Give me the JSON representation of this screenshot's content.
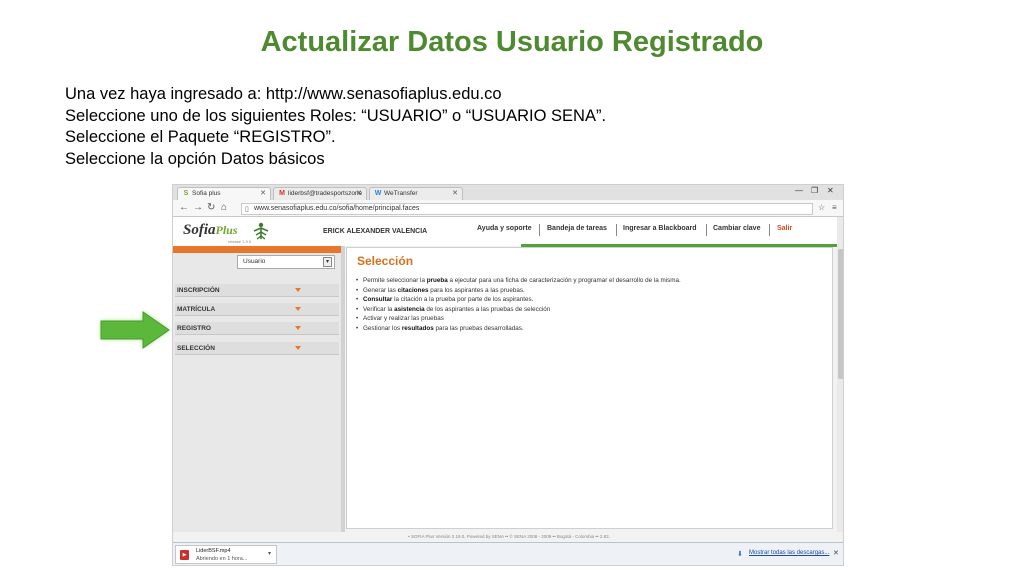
{
  "slide": {
    "title": "Actualizar Datos Usuario Registrado",
    "lines": [
      "Una vez haya ingresado a: http://www.senasofiaplus.edu.co",
      "Seleccione uno de los siguientes Roles: “USUARIO” o “USUARIO SENA”.",
      "Seleccione el Paquete “REGISTRO”.",
      "Seleccione la opción Datos básicos"
    ]
  },
  "browser": {
    "tabs": [
      {
        "label": "Sofia plus",
        "icon": "sofia-favicon"
      },
      {
        "label": "liderbsf@tradesportszone",
        "icon": "gmail-favicon"
      },
      {
        "label": "WeTransfer",
        "icon": "wetransfer-favicon"
      }
    ],
    "url": "www.senasofiaplus.edu.co/sofia/home/principal.faces"
  },
  "site": {
    "logo_text": "Sofia",
    "logo_plus": "Plus",
    "logo_version": "release 1.9.0",
    "user_name": "ERICK ALEXANDER VALENCIA",
    "nav": {
      "help": "Ayuda y soporte",
      "tasks": "Bandeja de tareas",
      "blackboard": "Ingresar a Blackboard",
      "change_password": "Cambiar clave",
      "logout": "Salir"
    },
    "role_selected": "Usuario",
    "menu": [
      "INSCRIPCIÓN",
      "MATRÍCULA",
      "REGISTRO",
      "SELECCIÓN"
    ],
    "content": {
      "title": "Selección",
      "bullets": [
        {
          "pre": "Permite seleccionar la ",
          "bold": "prueba",
          "post": " a ejecutar para una ficha de caracterización y programar el desarrollo de la misma."
        },
        {
          "pre": "Generar las ",
          "bold": "citaciones",
          "post": " para los aspirantes a las pruebas."
        },
        {
          "pre": "",
          "bold": "Consultar",
          "post": " la citación a la prueba por parte de los aspirantes."
        },
        {
          "pre": "Verificar la ",
          "bold": "asistencia",
          "post": " de los aspirantes a las pruebas de selección"
        },
        {
          "pre": "Activar y realizar las pruebas",
          "bold": "",
          "post": ""
        },
        {
          "pre": "Gestionar los ",
          "bold": "resultados",
          "post": " para las pruebas desarrolladas."
        }
      ]
    },
    "footer": "• SOFIA Plus Versión 2.19.0, Powered by SENA •• © SENA 2008 - 2009 •• Bogotá - Colombia •• 2.83."
  },
  "downloads": {
    "file_name": "LiderBSF.mp4",
    "file_status": "Abriendo en 1 hora...",
    "show_all": "Mostrar todas las descargas..."
  }
}
